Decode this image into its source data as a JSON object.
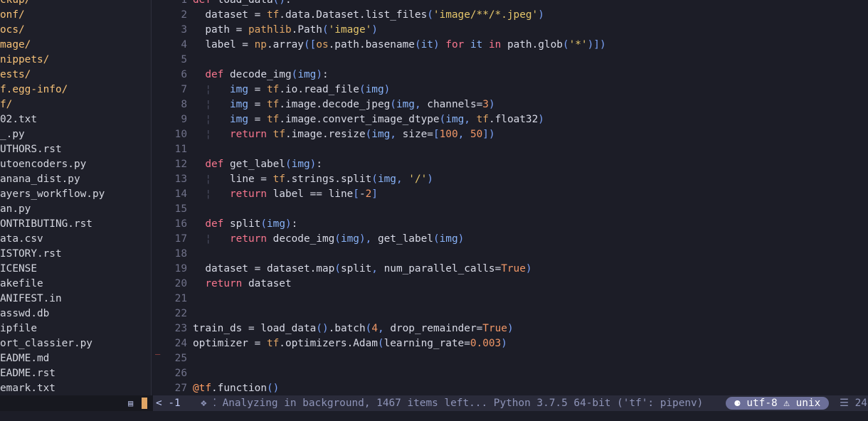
{
  "file_tree": [
    {
      "label": "ckup/",
      "dir": true
    },
    {
      "label": "onf/",
      "dir": true
    },
    {
      "label": "ocs/",
      "dir": true
    },
    {
      "label": "mage/",
      "dir": true
    },
    {
      "label": "nippets/",
      "dir": true
    },
    {
      "label": "ests/",
      "dir": true
    },
    {
      "label": "f.egg-info/",
      "dir": true
    },
    {
      "label": "f/",
      "dir": true
    },
    {
      "label": "02.txt",
      "dir": false
    },
    {
      "label": "_.py",
      "dir": false
    },
    {
      "label": "UTHORS.rst",
      "dir": false
    },
    {
      "label": "utoencoders.py",
      "dir": false
    },
    {
      "label": "anana_dist.py",
      "dir": false
    },
    {
      "label": "ayers_workflow.py",
      "dir": false
    },
    {
      "label": "an.py",
      "dir": false
    },
    {
      "label": "ONTRIBUTING.rst",
      "dir": false
    },
    {
      "label": "ata.csv",
      "dir": false
    },
    {
      "label": "ISTORY.rst",
      "dir": false
    },
    {
      "label": "ICENSE",
      "dir": false
    },
    {
      "label": "akefile",
      "dir": false
    },
    {
      "label": "ANIFEST.in",
      "dir": false
    },
    {
      "label": "asswd.db",
      "dir": false
    },
    {
      "label": "ipfile",
      "dir": false
    },
    {
      "label": "ort_classier.py",
      "dir": false
    },
    {
      "label": "EADME.md",
      "dir": false
    },
    {
      "label": "EADME.rst",
      "dir": false
    },
    {
      "label": "emark.txt",
      "dir": false
    }
  ],
  "editor": {
    "line_numbers": [
      "1",
      "2",
      "3",
      "4",
      "5",
      "6",
      "7",
      "8",
      "9",
      "10",
      "11",
      "12",
      "13",
      "14",
      "15",
      "16",
      "17",
      "18",
      "19",
      "20",
      "21",
      "22",
      "23",
      "24",
      "25",
      "26",
      "27"
    ],
    "lines": [
      "def load_data():",
      "  dataset = tf.data.Dataset.list_files('image/**/*.jpeg')",
      "  path = pathlib.Path('image')",
      "  label = np.array([os.path.basename(it) for it in path.glob('*')])",
      "",
      "  def decode_img(img):",
      "    img = tf.io.read_file(img)",
      "    img = tf.image.decode_jpeg(img, channels=3)",
      "    img = tf.image.convert_image_dtype(img, tf.float32)",
      "    return tf.image.resize(img, size=[100, 50])",
      "",
      "  def get_label(img):",
      "    line = tf.strings.split(img, '/')",
      "    return label == line[-2]",
      "",
      "  def split(img):",
      "    return decode_img(img), get_label(img)",
      "",
      "  dataset = dataset.map(split, num_parallel_calls=True)",
      "  return dataset",
      "",
      "",
      "train_ds = load_data().batch(4, drop_remainder=True)",
      "optimizer = tf.optimizers.Adam(learning_rate=0.003)",
      "",
      "",
      "@tf.function()"
    ],
    "error_sign": "_"
  },
  "statusbar": {
    "file_icon": "file-icon",
    "position": "< -1",
    "message": "❖ ⁚ Analyzing in background, 1467 items left... Python 3.7.5 64-bit ('tf': pipenv)",
    "encoding": "⚈ utf-8 ⚠ unix",
    "right_text": "☰ 24:"
  },
  "colors": {
    "background": "#1c1d27",
    "directory": "#f6c177",
    "keyword": "#f7768e",
    "accent_pill": "#6c6f98"
  }
}
